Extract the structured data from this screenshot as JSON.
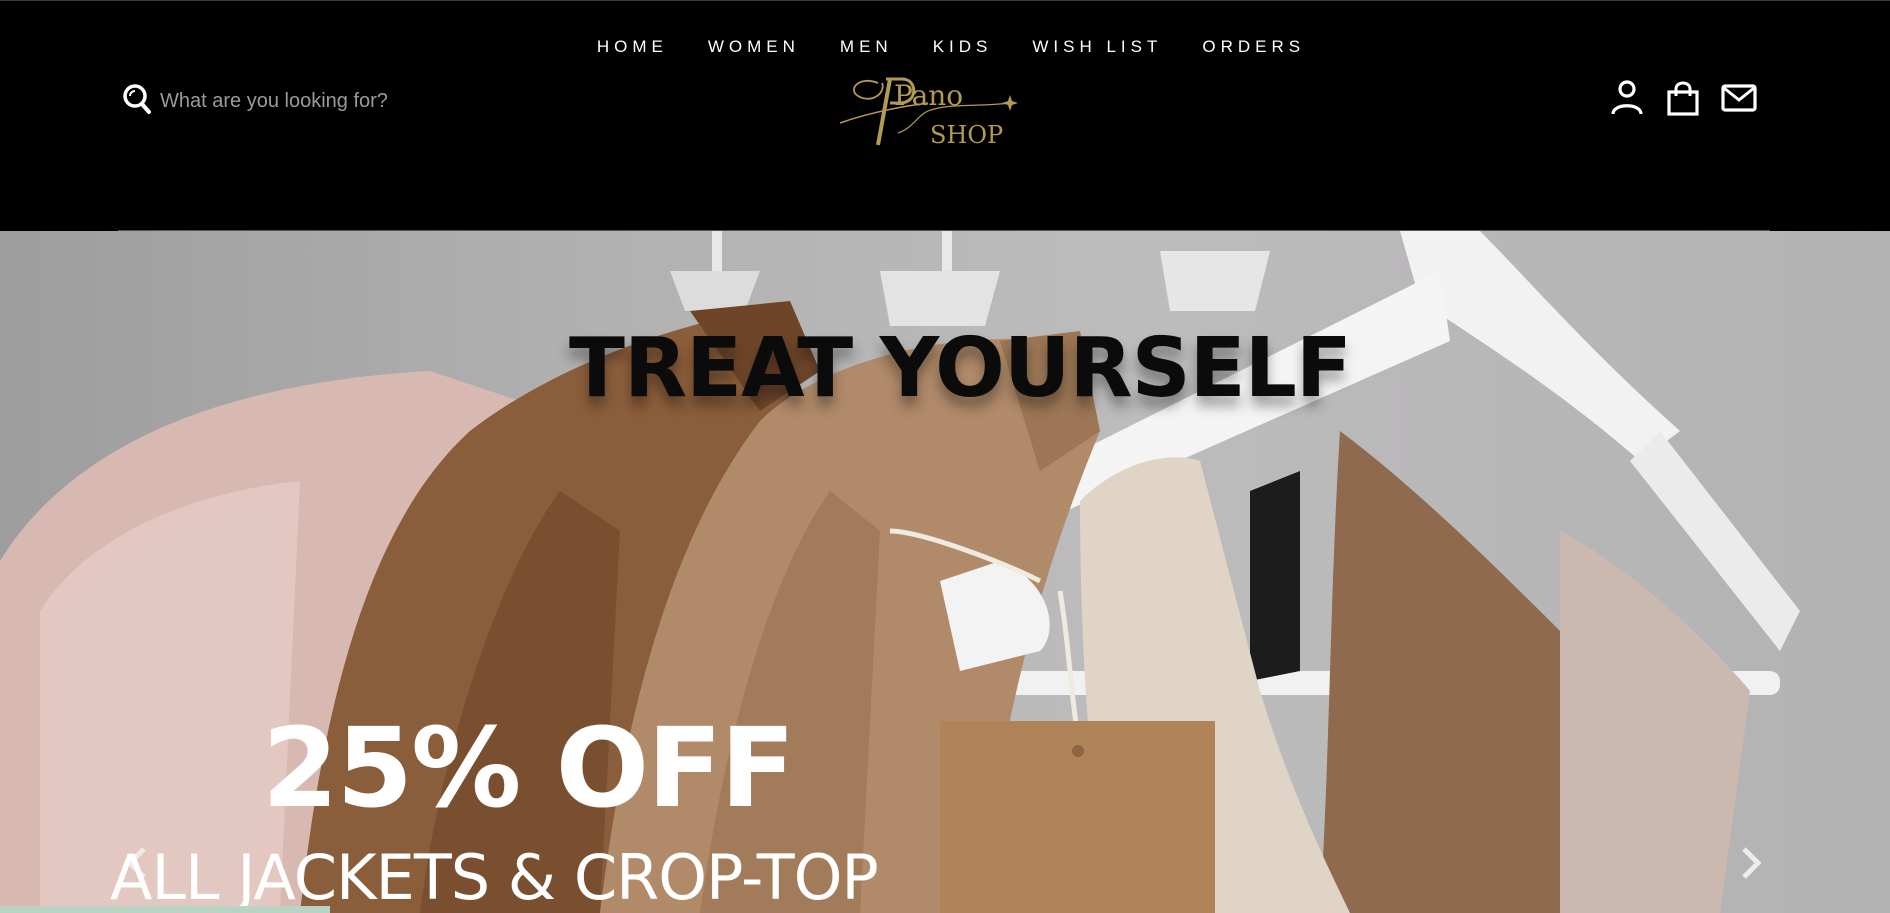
{
  "nav": {
    "items": [
      "HOME",
      "WOMEN",
      "MEN",
      "KIDS",
      "WISH LIST",
      "ORDERS"
    ]
  },
  "search": {
    "placeholder": "What are you looking for?"
  },
  "logo": {
    "line1": "Pano",
    "line2": "SHOP"
  },
  "header_icons": [
    "user-icon",
    "shopping-bag-icon",
    "mail-icon"
  ],
  "hero": {
    "title": "TREAT YOURSELF",
    "discount": "25% OFF",
    "subtitle": "ALL JACKETS & CROP-TOP"
  },
  "colors": {
    "brand_gold": "#b39a52",
    "header_bg": "#000000"
  }
}
